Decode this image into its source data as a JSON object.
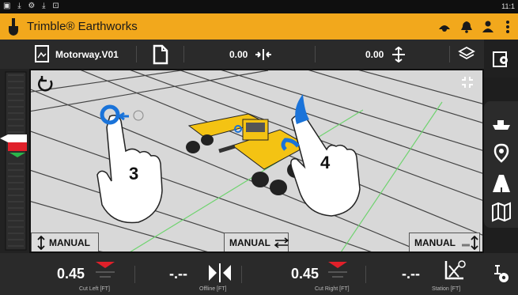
{
  "status_bar": {
    "icons": "▣ ⤓ ⚙ ⤓ ⊡",
    "time": "11:1"
  },
  "app": {
    "title": "Trimble® Earthworks"
  },
  "toolbar": {
    "design_name": "Motorway.V01",
    "cross_slope_value": "0.00",
    "main_fall_value": "0.00"
  },
  "viewport": {
    "hand_left_label": "3",
    "hand_right_label": "4"
  },
  "manual_buttons": {
    "left": "MANUAL",
    "center": "MANUAL",
    "right": "MANUAL"
  },
  "guidance": {
    "cut_left": {
      "value": "0.45",
      "label": "Cut Left  [FT]"
    },
    "offline": {
      "value": "-.--",
      "label": "Offline  [FT]"
    },
    "cut_right": {
      "value": "0.45",
      "label": "Cut Right  [FT]"
    },
    "station": {
      "value": "-.--",
      "label": "Station  [FT]"
    }
  },
  "colors": {
    "accent": "#f2a81c",
    "cut_indicator": "#e0202a",
    "on_grade": "#2ab54a",
    "design_line": "#6fd36f",
    "touch_blue": "#1a73d9"
  },
  "icons": {
    "logo": "trimble-shovel-icon",
    "settings": "gear-icon",
    "layers": "layers-icon",
    "new_file": "file-icon"
  }
}
